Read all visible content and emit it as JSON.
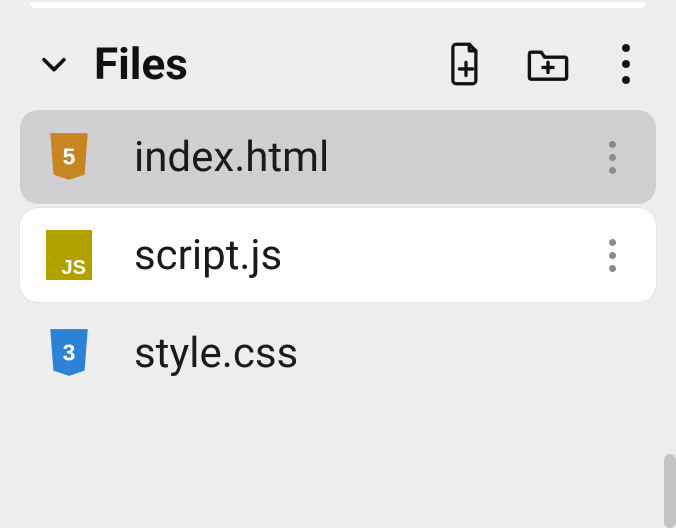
{
  "section": {
    "title": "Files"
  },
  "files": [
    {
      "name": "index.html",
      "icon": "html5-icon",
      "state": "selected"
    },
    {
      "name": "script.js",
      "icon": "js-icon",
      "state": "active"
    },
    {
      "name": "style.css",
      "icon": "css3-icon",
      "state": ""
    }
  ],
  "icons": {
    "html5_color": "#c78621",
    "js_bg": "#b3a100",
    "css3_color": "#2d82d7"
  }
}
